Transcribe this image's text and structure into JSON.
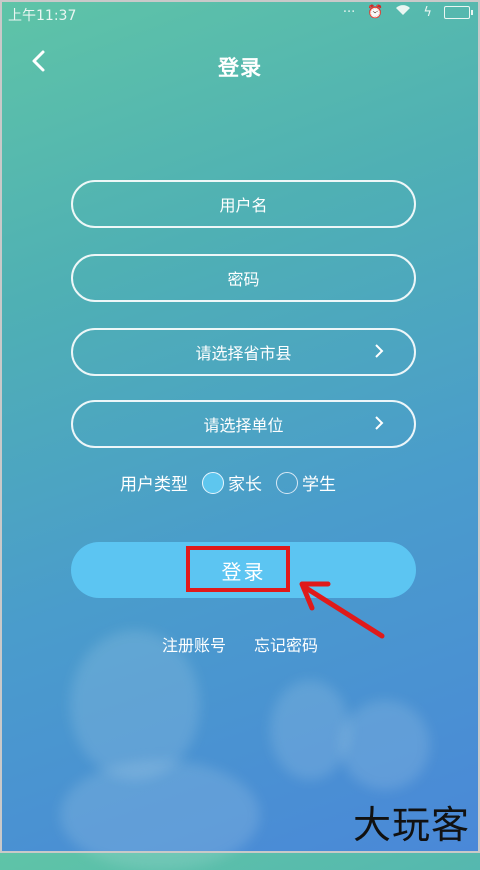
{
  "status_bar": {
    "time": "上午11:37"
  },
  "header": {
    "title": "登录"
  },
  "form": {
    "username_placeholder": "用户名",
    "password_placeholder": "密码",
    "region_placeholder": "请选择省市县",
    "unit_placeholder": "请选择单位",
    "user_type_label": "用户类型",
    "user_type_options": [
      {
        "label": "家长",
        "selected": true
      },
      {
        "label": "学生",
        "selected": false
      }
    ],
    "login_button": "登录"
  },
  "links": {
    "register": "注册账号",
    "forgot_password": "忘记密码"
  },
  "watermark": "大玩客",
  "colors": {
    "login_button": "#5cc5f2",
    "highlight": "#e01a1a",
    "radio_selected": "#5ec6ee"
  }
}
